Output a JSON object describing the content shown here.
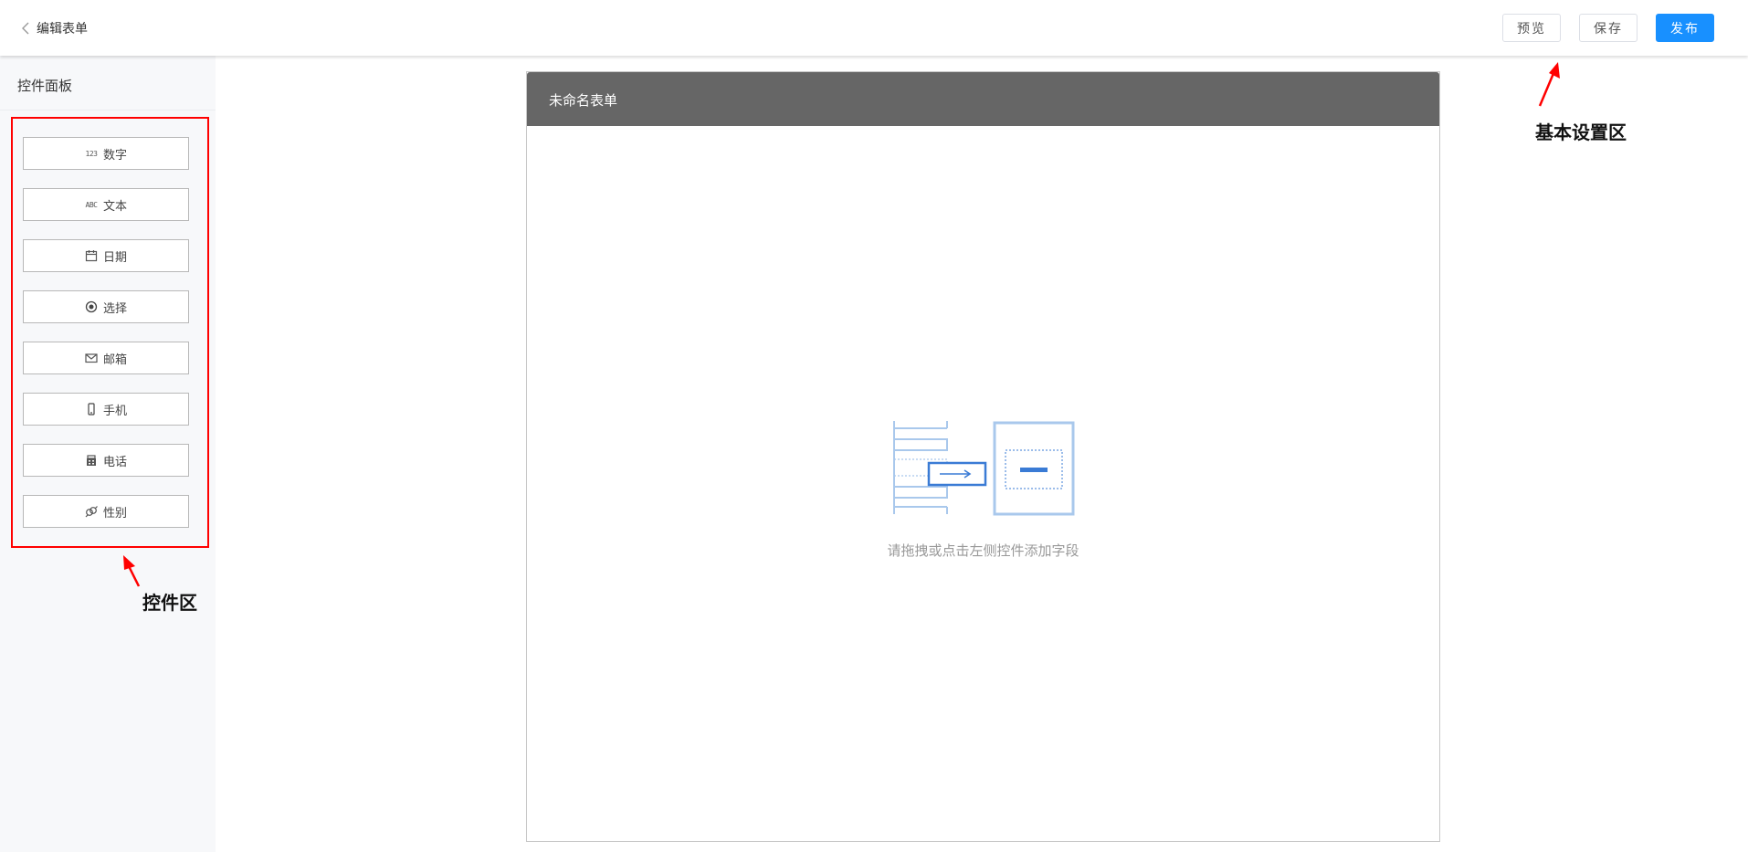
{
  "header": {
    "back_label": "编辑表单",
    "buttons": {
      "preview": "预览",
      "save": "保存",
      "publish": "发布"
    }
  },
  "sidebar": {
    "title": "控件面板",
    "controls": [
      {
        "label": "数字",
        "icon": "number-123-icon",
        "icon_text": "123"
      },
      {
        "label": "文本",
        "icon": "text-abc-icon",
        "icon_text": "ABC"
      },
      {
        "label": "日期",
        "icon": "calendar-icon"
      },
      {
        "label": "选择",
        "icon": "radio-icon"
      },
      {
        "label": "邮箱",
        "icon": "mail-icon"
      },
      {
        "label": "手机",
        "icon": "mobile-phone-icon"
      },
      {
        "label": "电话",
        "icon": "telephone-icon"
      },
      {
        "label": "性别",
        "icon": "gender-icon"
      }
    ]
  },
  "form": {
    "title": "未命名表单",
    "empty_hint": "请拖拽或点击左侧控件添加字段"
  },
  "annotations": {
    "controls_area_label": "控件区",
    "settings_area_label": "基本设置区",
    "color": "#ff0000"
  },
  "colors": {
    "primary": "#1890ff",
    "form_header": "#666666",
    "illustration": "#a9c8ec",
    "illustration_accent": "#3a7bd5"
  }
}
